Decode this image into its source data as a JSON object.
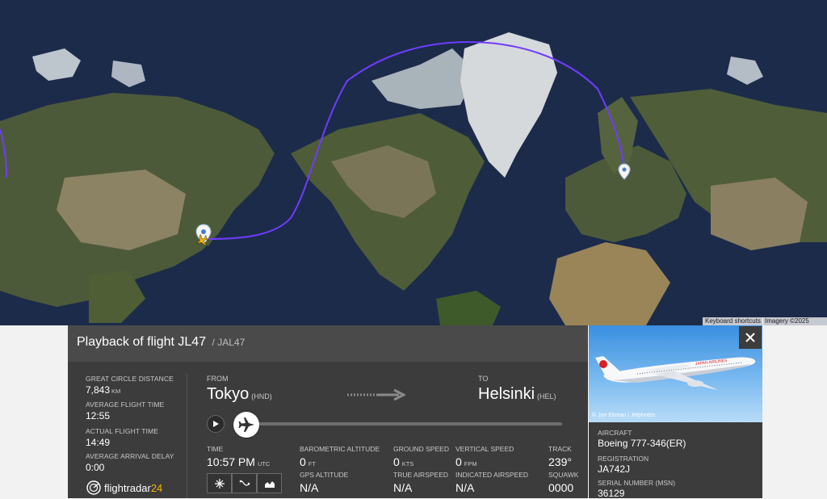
{
  "map": {
    "keyboard_shortcuts": "Keyboard shortcuts",
    "imagery_credit": "Imagery ©2025 NASA",
    "route_color": "#6f3cff",
    "origin_marker_icon": "location-pin-icon",
    "destination_marker_icon": "location-pin-icon",
    "aircraft_icon": "airplane-icon"
  },
  "panel": {
    "title": "Playback of flight JL47",
    "callsign": "/ JAL47"
  },
  "stats": {
    "distance_label": "GREAT CIRCLE DISTANCE",
    "distance_value": "7,843",
    "distance_unit": "KM",
    "avg_time_label": "AVERAGE FLIGHT TIME",
    "avg_time_value": "12:55",
    "actual_time_label": "ACTUAL FLIGHT TIME",
    "actual_time_value": "14:49",
    "delay_label": "AVERAGE ARRIVAL DELAY",
    "delay_value": "0:00"
  },
  "logo": {
    "text_main": "flightradar",
    "text_accent": "24"
  },
  "route": {
    "from_label": "FROM",
    "from_city": "Tokyo",
    "from_code": "(HND)",
    "to_label": "TO",
    "to_city": "Helsinki",
    "to_code": "(HEL)"
  },
  "playback": {
    "progress": 0.0,
    "play_icon": "play-icon",
    "handle_icon": "airplane-icon"
  },
  "flight_data": {
    "time_label": "TIME",
    "time_value": "10:57 PM",
    "time_unit": "UTC",
    "baro_alt_label": "BAROMETRIC ALTITUDE",
    "baro_alt_value": "0",
    "baro_alt_unit": "FT",
    "gps_alt_label": "GPS ALTITUDE",
    "gps_alt_value": "N/A",
    "ground_speed_label": "GROUND SPEED",
    "ground_speed_value": "0",
    "ground_speed_unit": "KTS",
    "true_airspeed_label": "TRUE AIRSPEED",
    "true_airspeed_value": "N/A",
    "vertical_speed_label": "VERTICAL SPEED",
    "vertical_speed_value": "0",
    "vertical_speed_unit": "FPM",
    "indicated_airspeed_label": "INDICATED AIRSPEED",
    "indicated_airspeed_value": "N/A",
    "track_label": "TRACK",
    "track_value": "239°",
    "squawk_label": "SQUAWK",
    "squawk_value": "0000"
  },
  "aircraft": {
    "photo_credit": "© Jon Ekman | Jetphotos",
    "photo_livery_text": "JAPAN AIRLINES",
    "aircraft_label": "AIRCRAFT",
    "aircraft_value": "Boeing 777-346(ER)",
    "registration_label": "REGISTRATION",
    "registration_value": "JA742J",
    "serial_label": "SERIAL NUMBER (MSN)",
    "serial_value": "36129"
  }
}
